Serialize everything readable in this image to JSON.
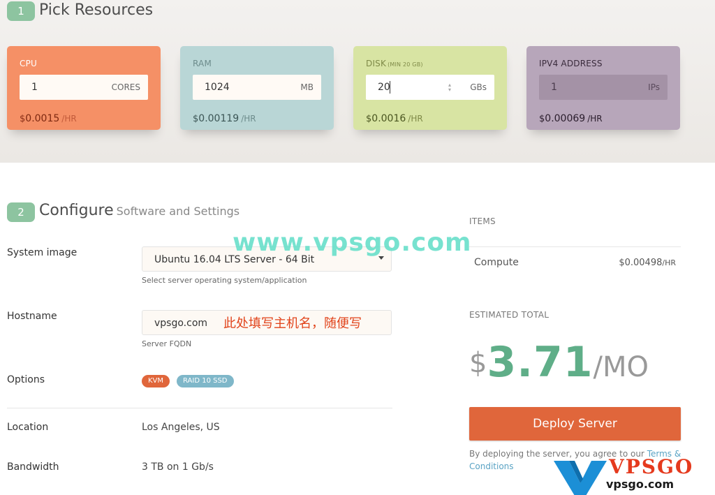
{
  "section1": {
    "step": "1",
    "title": "Pick Resources",
    "cards": {
      "cpu": {
        "label": "CPU",
        "value": "1",
        "unit": "CORES",
        "currency": "$",
        "price": "0.0015",
        "per": "/HR"
      },
      "ram": {
        "label": "RAM",
        "value": "1024",
        "unit": "MB",
        "currency": "$",
        "price": "0.00119",
        "per": "/HR"
      },
      "disk": {
        "label": "DISK",
        "label_small": "(MIN 20 GB)",
        "value": "20",
        "unit": "GBs",
        "currency": "$",
        "price": "0.0016",
        "per": "/HR"
      },
      "ip": {
        "label": "IPV4 ADDRESS",
        "value": "1",
        "unit": "IPs",
        "currency": "$",
        "price": "0.00069",
        "per": "/HR"
      }
    }
  },
  "section2": {
    "step": "2",
    "title": "Configure",
    "subtitle": "Software and Settings",
    "system_image": {
      "label": "System image",
      "value": "Ubuntu 16.04 LTS Server - 64 Bit",
      "helper": "Select server operating system/application"
    },
    "hostname": {
      "label": "Hostname",
      "value": "vpsgo.com",
      "annotation": "此处填写主机名，随便写",
      "helper": "Server FQDN"
    },
    "options": {
      "label": "Options",
      "tags": [
        "KVM",
        "RAID 10 SSD"
      ]
    },
    "location": {
      "label": "Location",
      "value": "Los Angeles, US"
    },
    "bandwidth": {
      "label": "Bandwidth",
      "value": "3 TB on 1 Gb/s"
    }
  },
  "summary": {
    "items_heading": "ITEMS",
    "item_name": "Compute",
    "item_currency": "$",
    "item_price": "0.00498",
    "item_per": "/HR",
    "total_heading": "ESTIMATED TOTAL",
    "total_currency": "$",
    "total_amount": "3.71",
    "total_per": "/MO",
    "deploy_label": "Deploy Server",
    "terms_text": "By deploying the server, you agree to our ",
    "terms_link": "Terms & Conditions"
  },
  "watermark": {
    "text": "www.vpsgo.com",
    "logo_title": "VPSGO",
    "logo_url": "vpsgo.com"
  },
  "colors": {
    "cpu": "#f59066",
    "ram": "#b9d6d6",
    "disk": "#d8e4a3",
    "ip": "#b7a6ba",
    "accent_green": "#5fae88",
    "deploy": "#e0663b",
    "kvm_tag": "#e0663b",
    "raid_tag": "#7fb7c9"
  }
}
